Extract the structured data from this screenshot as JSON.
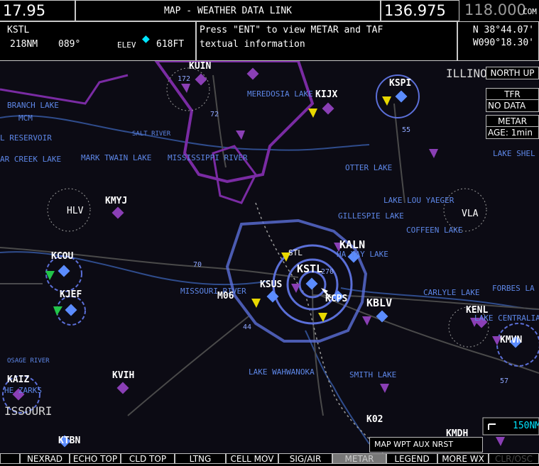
{
  "header": {
    "active_nav": "17.95",
    "title": "MAP - WEATHER DATA LINK",
    "active_com": "136.975",
    "standby_com": "118.000",
    "com_label": "COM"
  },
  "info_bar": {
    "waypoint": "KSTL",
    "distance": "218NM",
    "bearing": "089°",
    "elev_label": "ELEV",
    "elev_value": "618FT",
    "message_line1": "Press \"ENT\" to view METAR and TAF",
    "message_line2": "textual information",
    "lat": "N 38°44.07'",
    "lon": "W090°18.30'"
  },
  "right_panel": {
    "orientation": "NORTH UP",
    "tfr_label": "TFR",
    "tfr_status": "NO DATA",
    "metar_label": "METAR",
    "metar_age": "AGE: 1min"
  },
  "map_labels": {
    "water": [
      "BRANCH LAKE",
      "MCM",
      "L RESERVOIR",
      "SALT RIVER",
      "AR CREEK LAKE",
      "MARK TWAIN LAKE",
      "MISSISSIPPI RIVER",
      "MEREDOSIA LAKE",
      "OTTER LAKE",
      "LAKE LOU YAEGER",
      "GILLESPIE LAKE",
      "COFFEEN LAKE",
      "LAKE SHEL",
      "HA YAY LAKE",
      "MISSOURI RIVER",
      "CARLYLE LAKE",
      "FORBES LA",
      "LAKE CENTRALIA",
      "LAKE WAHWANOKA",
      "SMITH LAKE",
      "OSAGE RIVER",
      "HE ZARKS",
      "STL"
    ],
    "airports": [
      "KUIN",
      "KIJX",
      "KSPI",
      "KMYJ",
      "HLV",
      "VLA",
      "KALN",
      "KCOU",
      "KSTL",
      "KSUS",
      "M06",
      "KCPS",
      "KBLV",
      "KJEF",
      "KENL",
      "KMVN",
      "KAIZ",
      "KVIH",
      "K02",
      "KTBN",
      "KMDH"
    ],
    "states": [
      "ILLINO",
      "ISSOURI"
    ],
    "highways": [
      "172",
      "72",
      "55",
      "70",
      "270",
      "44",
      "57"
    ]
  },
  "range": "150NM",
  "pager": {
    "text": "MAP WPT AUX NRST"
  },
  "softkeys": [
    "NEXRAD",
    "ECHO TOP",
    "CLD TOP",
    "LTNG",
    "CELL MOV",
    "SIG/AIR",
    "METAR",
    "LEGEND",
    "MORE WX",
    "CLR/OSC"
  ],
  "colors": {
    "background": "#0c0b14",
    "airspace": "#5b6fd8",
    "sua": "#7a2ba3",
    "metar_vfr": "#8a3fb5",
    "metar_ifr": "#e8d800",
    "metar_green": "#22c44a",
    "text": "#ffffff",
    "cyan": "#00e5ff"
  }
}
